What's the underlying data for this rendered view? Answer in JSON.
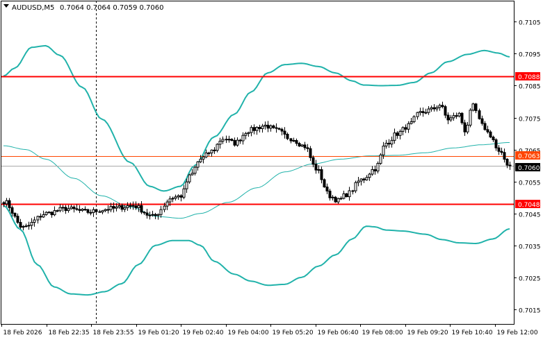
{
  "header": {
    "symbol": "AUDUSD,M5",
    "ohlc": "0.7064 0.7064 0.7059 0.7060"
  },
  "colors": {
    "up_candle": "#000000",
    "down_candle": "#000000",
    "bollinger": "#20b2aa",
    "level": "#ff0000",
    "bid_line": "#a9a9a9",
    "ask_line": "#ff4500",
    "price_label_bg": "#000000",
    "price_label_text": "#ffffff"
  },
  "chart_data": {
    "type": "candlestick",
    "y_range": [
      0.70104,
      0.71116
    ],
    "y_ticks": [
      "0.7105",
      "0.7095",
      "0.7085",
      "0.7075",
      "0.7065",
      "0.7055",
      "0.7045",
      "0.7035",
      "0.7025",
      "0.7015"
    ],
    "x_ticks": [
      "18 Feb 2026",
      "18 Feb 22:35",
      "18 Feb 23:55",
      "19 Feb 01:20",
      "19 Feb 02:40",
      "19 Feb 04:00",
      "19 Feb 05:20",
      "19 Feb 06:40",
      "19 Feb 08:00",
      "19 Feb 09:20",
      "19 Feb 10:40",
      "19 Feb 12:00"
    ],
    "bar_count": 181,
    "path_anchors": [
      [
        0,
        0.70488
      ],
      [
        7,
        0.70405
      ],
      [
        15,
        0.7045
      ],
      [
        22,
        0.70465
      ],
      [
        30,
        0.70455
      ],
      [
        38,
        0.70465
      ],
      [
        46,
        0.70475
      ],
      [
        53,
        0.7044
      ],
      [
        60,
        0.705
      ],
      [
        63,
        0.70505
      ],
      [
        66,
        0.70565
      ],
      [
        70,
        0.7062
      ],
      [
        74,
        0.70645
      ],
      [
        78,
        0.70685
      ],
      [
        82,
        0.7067
      ],
      [
        87,
        0.7071
      ],
      [
        93,
        0.70725
      ],
      [
        97,
        0.7071
      ],
      [
        102,
        0.70685
      ],
      [
        107,
        0.7066
      ],
      [
        111,
        0.7059
      ],
      [
        116,
        0.70505
      ],
      [
        119,
        0.7049
      ],
      [
        122,
        0.7051
      ],
      [
        127,
        0.70555
      ],
      [
        132,
        0.7059
      ],
      [
        136,
        0.7067
      ],
      [
        140,
        0.707
      ],
      [
        144,
        0.70725
      ],
      [
        148,
        0.70765
      ],
      [
        152,
        0.70775
      ],
      [
        155,
        0.7079
      ],
      [
        158,
        0.70745
      ],
      [
        162,
        0.7076
      ],
      [
        164,
        0.7071
      ],
      [
        167,
        0.70785
      ],
      [
        170,
        0.70725
      ],
      [
        173,
        0.70695
      ],
      [
        176,
        0.7064
      ],
      [
        180,
        0.706
      ]
    ],
    "upper_band": [
      [
        0,
        0.7088
      ],
      [
        4,
        0.70905
      ],
      [
        10,
        0.7097
      ],
      [
        15,
        0.70975
      ],
      [
        20,
        0.70945
      ],
      [
        28,
        0.70845
      ],
      [
        35,
        0.70745
      ],
      [
        45,
        0.7061
      ],
      [
        52,
        0.70535
      ],
      [
        57,
        0.7052
      ],
      [
        63,
        0.70535
      ],
      [
        68,
        0.706
      ],
      [
        75,
        0.7069
      ],
      [
        82,
        0.7076
      ],
      [
        88,
        0.7083
      ],
      [
        94,
        0.7089
      ],
      [
        100,
        0.70916
      ],
      [
        106,
        0.7092
      ],
      [
        112,
        0.7091
      ],
      [
        118,
        0.7089
      ],
      [
        124,
        0.70865
      ],
      [
        128,
        0.70852
      ],
      [
        134,
        0.7085
      ],
      [
        140,
        0.70851
      ],
      [
        146,
        0.7086
      ],
      [
        152,
        0.7089
      ],
      [
        158,
        0.70925
      ],
      [
        165,
        0.70948
      ],
      [
        171,
        0.7096
      ],
      [
        176,
        0.70952
      ],
      [
        180,
        0.7094
      ]
    ],
    "middle_band": [
      [
        0,
        0.70662
      ],
      [
        8,
        0.7065
      ],
      [
        15,
        0.7062
      ],
      [
        25,
        0.7056
      ],
      [
        35,
        0.70505
      ],
      [
        45,
        0.7047
      ],
      [
        55,
        0.7044
      ],
      [
        63,
        0.70435
      ],
      [
        70,
        0.7045
      ],
      [
        80,
        0.70485
      ],
      [
        90,
        0.7053
      ],
      [
        100,
        0.7058
      ],
      [
        110,
        0.70605
      ],
      [
        120,
        0.7062
      ],
      [
        130,
        0.7063
      ],
      [
        140,
        0.70632
      ],
      [
        150,
        0.7064
      ],
      [
        160,
        0.70655
      ],
      [
        170,
        0.70665
      ],
      [
        180,
        0.70672
      ]
    ],
    "lower_band": [
      [
        0,
        0.70475
      ],
      [
        6,
        0.704
      ],
      [
        12,
        0.7029
      ],
      [
        18,
        0.7022
      ],
      [
        24,
        0.70198
      ],
      [
        30,
        0.70195
      ],
      [
        36,
        0.70205
      ],
      [
        42,
        0.7023
      ],
      [
        48,
        0.7029
      ],
      [
        54,
        0.7035
      ],
      [
        60,
        0.70365
      ],
      [
        66,
        0.70365
      ],
      [
        70,
        0.7035
      ],
      [
        75,
        0.703
      ],
      [
        82,
        0.7026
      ],
      [
        88,
        0.70238
      ],
      [
        94,
        0.70225
      ],
      [
        100,
        0.70228
      ],
      [
        106,
        0.7025
      ],
      [
        112,
        0.70285
      ],
      [
        118,
        0.7032
      ],
      [
        124,
        0.7037
      ],
      [
        129,
        0.7041
      ],
      [
        132,
        0.70408
      ],
      [
        136,
        0.70398
      ],
      [
        142,
        0.70395
      ],
      [
        150,
        0.70385
      ],
      [
        156,
        0.70368
      ],
      [
        162,
        0.70358
      ],
      [
        168,
        0.70356
      ],
      [
        174,
        0.7037
      ],
      [
        180,
        0.70402
      ]
    ],
    "levels": [
      {
        "value": 0.7088,
        "label": "0.7088"
      },
      {
        "value": 0.7048,
        "label": "0.7048"
      }
    ],
    "bid": {
      "value": 0.706,
      "label": "0.7060"
    },
    "ask": {
      "value": 0.7063,
      "label": "0.7063"
    },
    "separator_bar": 33
  }
}
